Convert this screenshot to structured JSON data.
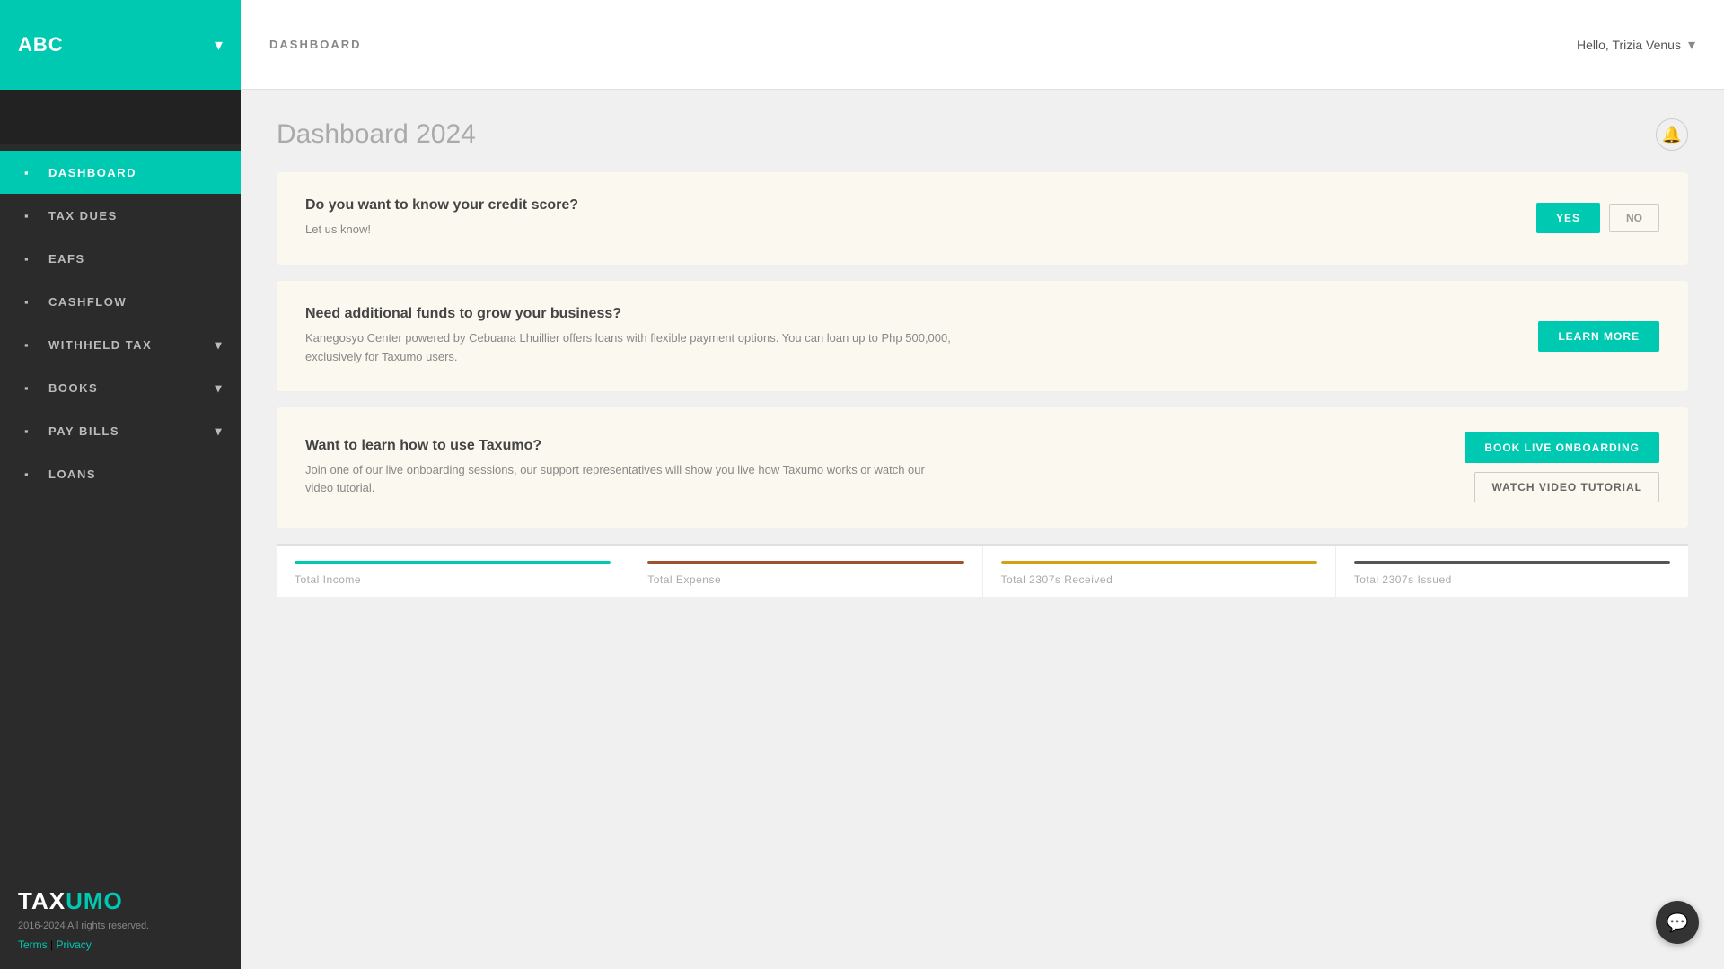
{
  "sidebar": {
    "company": "ABC",
    "nav_items": [
      {
        "id": "dashboard",
        "label": "DASHBOARD",
        "active": true,
        "has_arrow": false
      },
      {
        "id": "tax-dues",
        "label": "TAX DUES",
        "active": false,
        "has_arrow": false
      },
      {
        "id": "eafs",
        "label": "EAFS",
        "active": false,
        "has_arrow": false
      },
      {
        "id": "cashflow",
        "label": "CASHFLOW",
        "active": false,
        "has_arrow": false
      },
      {
        "id": "withheld-tax",
        "label": "WITHHELD TAX",
        "active": false,
        "has_arrow": true
      },
      {
        "id": "books",
        "label": "BOOKS",
        "active": false,
        "has_arrow": true
      },
      {
        "id": "pay-bills",
        "label": "PAY BILLS",
        "active": false,
        "has_arrow": true
      },
      {
        "id": "loans",
        "label": "LOANS",
        "active": false,
        "has_arrow": false
      }
    ],
    "logo": "TAX",
    "logo_accent": "UMO",
    "copyright": "2016-2024 All rights reserved.",
    "terms_label": "Terms",
    "privacy_label": "Privacy"
  },
  "topbar": {
    "title": "DASHBOARD",
    "user_greeting": "Hello, Trizia Venus"
  },
  "dashboard": {
    "page_title": "Dashboard 2024",
    "cards": [
      {
        "id": "credit-score",
        "heading": "Do you want to know your credit score?",
        "description": "Let us know!",
        "actions": [
          {
            "label": "YES",
            "type": "teal"
          },
          {
            "label": "NO",
            "type": "no"
          }
        ],
        "actions_layout": "row"
      },
      {
        "id": "funds",
        "heading": "Need additional funds to grow your business?",
        "description": "Kanegosyo Center powered by Cebuana Lhuillier offers loans with flexible payment options. You can loan up to Php 500,000, exclusively for Taxumo users.",
        "actions": [
          {
            "label": "LEARN MORE",
            "type": "teal"
          }
        ],
        "actions_layout": "column"
      },
      {
        "id": "onboarding",
        "heading": "Want to learn how to use Taxumo?",
        "description": "Join one of our live onboarding sessions, our support representatives will show you live how Taxumo works or watch our video tutorial.",
        "actions": [
          {
            "label": "BOOK LIVE ONBOARDING",
            "type": "teal"
          },
          {
            "label": "WATCH VIDEO TUTORIAL",
            "type": "outline"
          }
        ],
        "actions_layout": "column"
      }
    ],
    "stats": [
      {
        "label": "Total Income",
        "color": "#00c9b1"
      },
      {
        "label": "Total Expense",
        "color": "#a0522d"
      },
      {
        "label": "Total 2307s Received",
        "color": "#d4a017"
      },
      {
        "label": "Total 2307s Issued",
        "color": "#555"
      }
    ]
  }
}
